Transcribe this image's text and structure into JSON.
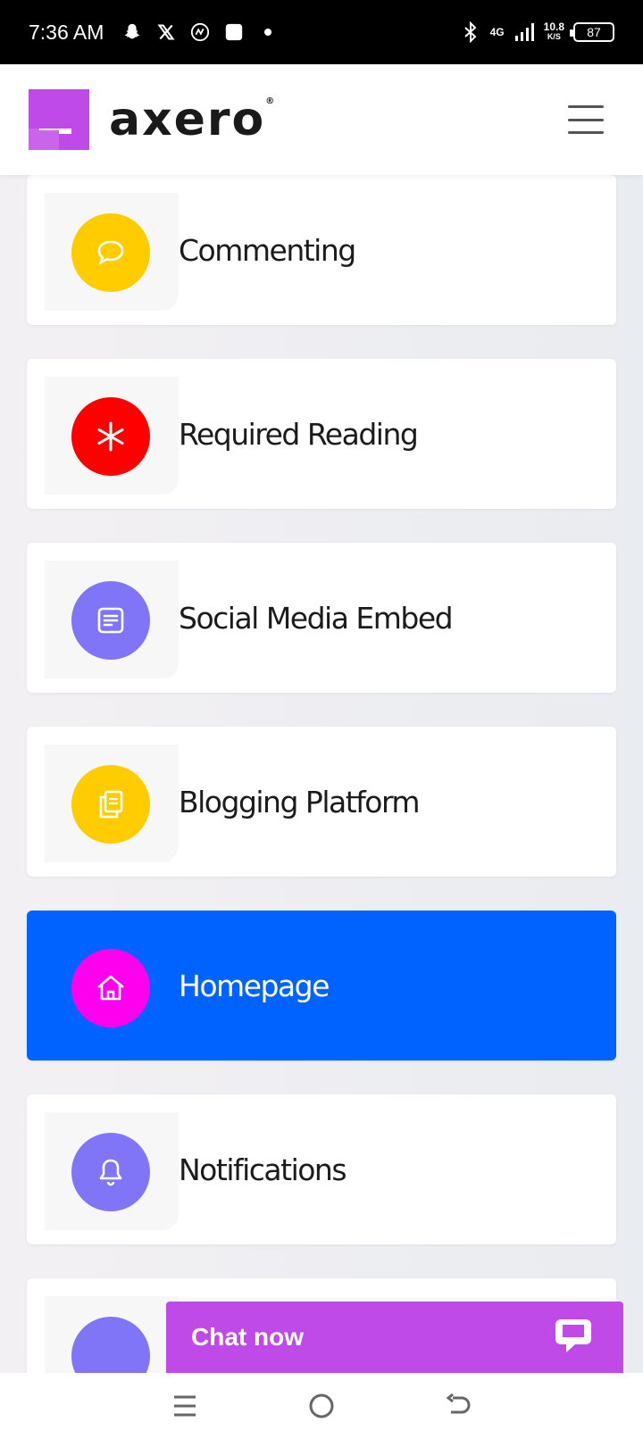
{
  "status_bar": {
    "time": "7:36 AM",
    "network": "4G",
    "speed_value": "10.8",
    "speed_unit": "K/S",
    "battery": "87"
  },
  "header": {
    "logo_text": "axero",
    "logo_mark": "®",
    "brand_color": "#c04ae8"
  },
  "cards": [
    {
      "label": "Commenting",
      "icon": "comment-icon",
      "circle_color": "#ffcc00",
      "active": false
    },
    {
      "label": "Required Reading",
      "icon": "asterisk-icon",
      "circle_color": "#ff0000",
      "active": false
    },
    {
      "label": "Social Media Embed",
      "icon": "document-icon",
      "circle_color": "#8075f7",
      "active": false
    },
    {
      "label": "Blogging Platform",
      "icon": "copy-pages-icon",
      "circle_color": "#ffcc00",
      "active": false
    },
    {
      "label": "Homepage",
      "icon": "home-icon",
      "circle_color": "#ff00ee",
      "active": true
    },
    {
      "label": "Notifications",
      "icon": "bell-icon",
      "circle_color": "#8075f7",
      "active": false
    }
  ],
  "chat": {
    "label": "Chat now",
    "icon": "chat-bubble-icon"
  },
  "nav": {
    "icons": [
      "recents-icon",
      "home-circle-icon",
      "back-icon"
    ]
  }
}
